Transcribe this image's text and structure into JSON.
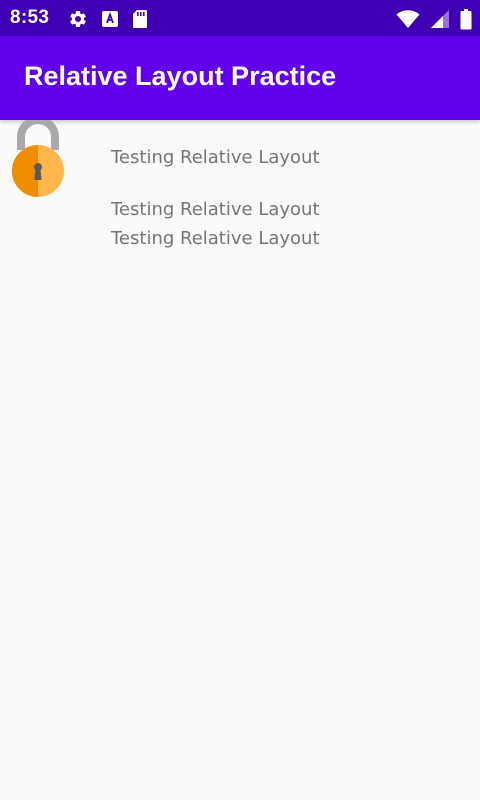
{
  "status_bar": {
    "time": "8:53",
    "left_icons": [
      "settings-gear-icon",
      "keyboard-a-icon",
      "sd-card-icon"
    ],
    "right_icons": [
      "wifi-icon",
      "cell-signal-icon",
      "battery-icon"
    ],
    "background": "#3f00b5"
  },
  "app_bar": {
    "title": "Relative Layout Practice",
    "background": "#6200ee"
  },
  "content": {
    "image_icon": "padlock-icon",
    "lines": [
      "Testing Relative Layout",
      "Testing Relative Layout",
      "Testing Relative Layout"
    ],
    "text_color": "#757575",
    "background": "#fafafa"
  }
}
